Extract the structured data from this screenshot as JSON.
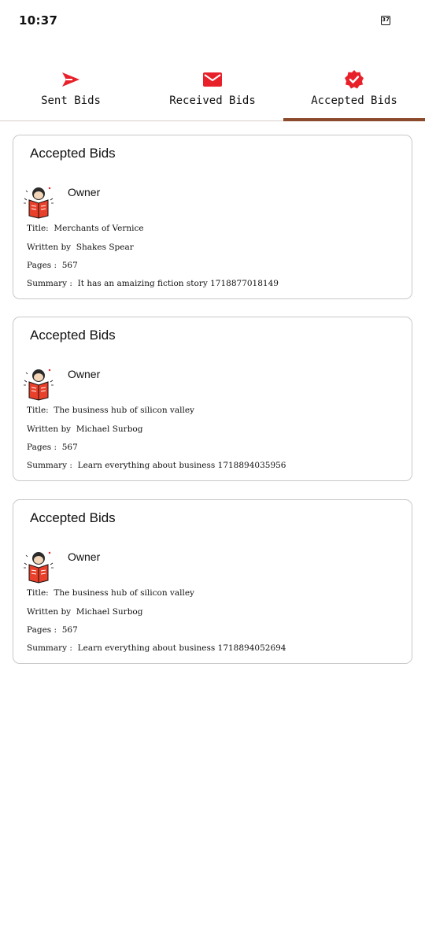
{
  "status_bar": {
    "time": "10:37",
    "battery": "37"
  },
  "tabs": [
    {
      "label": "Sent Bids",
      "icon": "send-icon",
      "active": false
    },
    {
      "label": "Received Bids",
      "icon": "mail-icon",
      "active": false
    },
    {
      "label": "Accepted Bids",
      "icon": "verified-badge-icon",
      "active": true
    }
  ],
  "colors": {
    "accent_red": "#e8202a",
    "tab_indicator": "#8b4a2b"
  },
  "labels": {
    "title": "Title:",
    "written_by": "Written by",
    "pages": "Pages :",
    "summary": "Summary :"
  },
  "cards": [
    {
      "heading": "Accepted Bids",
      "owner": "Owner",
      "title": "Merchants of Vernice",
      "author": "Shakes Spear",
      "pages": "567",
      "summary": "It has an amaizing fiction story  1718877018149"
    },
    {
      "heading": "Accepted Bids",
      "owner": "Owner",
      "title": "The business hub of silicon valley",
      "author": "Michael Surbog",
      "pages": "567",
      "summary": "Learn everything about business 1718894035956"
    },
    {
      "heading": "Accepted Bids",
      "owner": "Owner",
      "title": "The business hub of silicon valley",
      "author": "Michael Surbog",
      "pages": "567",
      "summary": "Learn everything about business 1718894052694"
    }
  ]
}
